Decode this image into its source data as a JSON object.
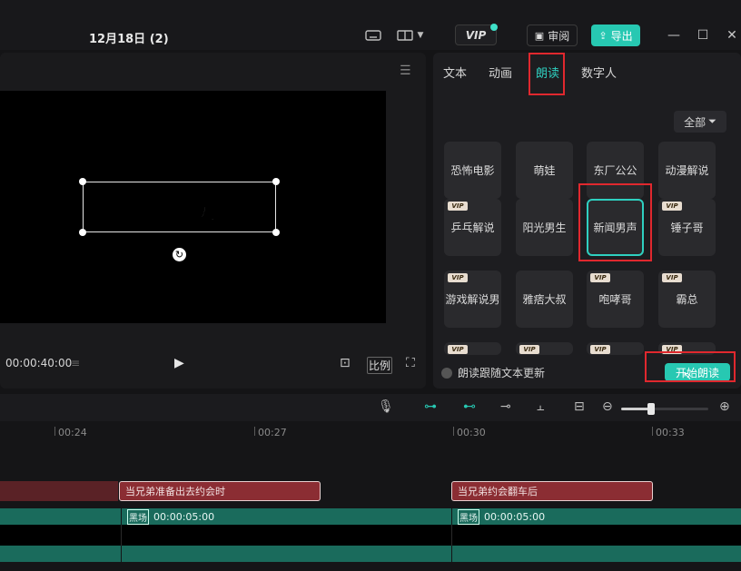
{
  "titlebar": {
    "project_name": "12月18日 (2)",
    "vip_label": "VIP",
    "review_label": "审阅",
    "export_label": "导出",
    "icons": [
      "keyboard-icon",
      "layout-icon",
      "chevron-down-icon",
      "minimize-icon",
      "maximize-icon",
      "close-icon"
    ]
  },
  "player": {
    "subtitle_text": "我好的兄弟",
    "timecode": "00:00:40:00",
    "ratio_label": "比例"
  },
  "panel": {
    "tabs": [
      "文本",
      "动画",
      "朗读",
      "数字人"
    ],
    "active_tab": "朗读",
    "filter_label": "全部",
    "voices": [
      {
        "name": "恐怖电影",
        "vip": false
      },
      {
        "name": "萌娃",
        "vip": false
      },
      {
        "name": "东厂公公",
        "vip": false
      },
      {
        "name": "动漫解说",
        "vip": false
      },
      {
        "name": "乒乓解说",
        "vip": true
      },
      {
        "name": "阳光男生",
        "vip": false
      },
      {
        "name": "新闻男声",
        "vip": false,
        "selected": true
      },
      {
        "name": "锤子哥",
        "vip": true
      },
      {
        "name": "游戏解说男",
        "vip": true
      },
      {
        "name": "雅痞大叔",
        "vip": false
      },
      {
        "name": "咆哮哥",
        "vip": true
      },
      {
        "name": "霸总",
        "vip": true
      }
    ],
    "vip_tag": "VIP",
    "follow_text_label": "朗读跟随文本更新",
    "start_button": "开始朗读"
  },
  "timeline": {
    "ticks": [
      "00:24",
      "00:27",
      "00:30",
      "00:33"
    ],
    "text_clips": [
      "当兄弟准备出去约会时",
      "当兄弟约会翻车后"
    ],
    "video_clips": [
      {
        "name": "黑场",
        "duration": "00:00:05:00"
      },
      {
        "name": "黑场",
        "duration": "00:00:05:00"
      }
    ]
  },
  "colors": {
    "accent": "#27c8b2",
    "highlight": "#e0282e",
    "text_clip": "#8b2d33",
    "video_clip": "#1a6b5c"
  }
}
